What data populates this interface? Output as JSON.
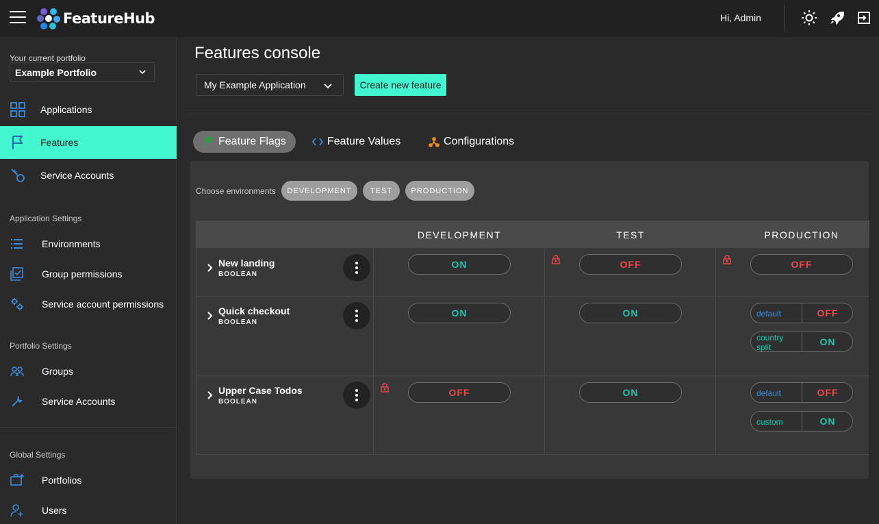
{
  "app": {
    "brand": "FeatureHub",
    "greeting": "Hi, Admin"
  },
  "sidebar": {
    "portfolio_label": "Your current portfolio",
    "portfolio_value": "Example Portfolio",
    "items": [
      {
        "label": "Applications"
      },
      {
        "label": "Features"
      },
      {
        "label": "Service Accounts"
      }
    ],
    "app_settings_label": "Application Settings",
    "app_settings": [
      {
        "label": "Environments"
      },
      {
        "label": "Group permissions"
      },
      {
        "label": "Service account permissions"
      }
    ],
    "portfolio_settings_label": "Portfolio Settings",
    "portfolio_settings": [
      {
        "label": "Groups"
      },
      {
        "label": "Service Accounts"
      }
    ],
    "global_settings_label": "Global Settings",
    "global_settings": [
      {
        "label": "Portfolios"
      },
      {
        "label": "Users"
      }
    ]
  },
  "main": {
    "title": "Features console",
    "app_select_value": "My Example Application",
    "create_button": "Create new feature",
    "tabs": [
      {
        "label": "Feature Flags"
      },
      {
        "label": "Feature Values"
      },
      {
        "label": "Configurations"
      }
    ],
    "env_label": "Choose environments",
    "env_chips": [
      "DEVELOPMENT",
      "TEST",
      "PRODUCTION"
    ],
    "columns": [
      "DEVELOPMENT",
      "TEST",
      "PRODUCTION"
    ],
    "features": [
      {
        "name": "New landing",
        "type": "BOOLEAN",
        "dev": "ON",
        "test": "OFF",
        "prod": "OFF"
      },
      {
        "name": "Quick checkout",
        "type": "BOOLEAN",
        "dev": "ON",
        "test": "ON",
        "prod_strategies": [
          {
            "name": "default",
            "value": "OFF"
          },
          {
            "name": "country split",
            "value": "ON"
          }
        ]
      },
      {
        "name": "Upper Case Todos",
        "type": "BOOLEAN",
        "dev": "OFF",
        "test": "ON",
        "prod_strategies": [
          {
            "name": "default",
            "value": "OFF"
          },
          {
            "name": "custom",
            "value": "ON"
          }
        ]
      }
    ]
  },
  "colors": {
    "accent": "#42f7d0",
    "on": "#21c6b0",
    "off": "#f2464b",
    "strategy_default": "#3b8bd9"
  }
}
